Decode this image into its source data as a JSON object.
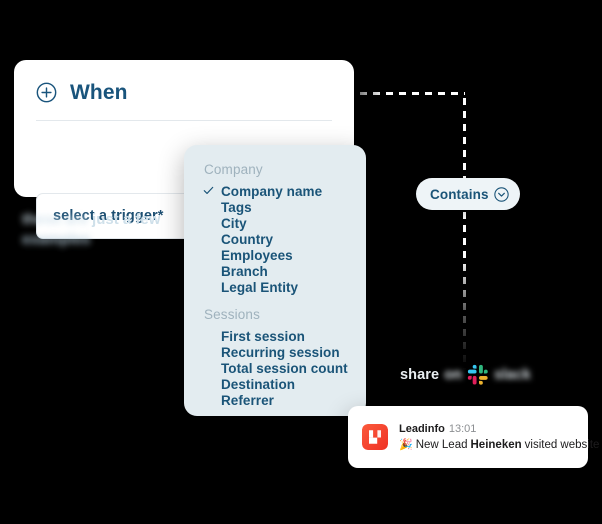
{
  "card": {
    "title": "When",
    "plus_icon": "circle-plus-icon",
    "trigger_placeholder": "select a trigger*"
  },
  "caption": {
    "obscured_prefix": "these are",
    "line1_visible": "just a few",
    "line2": "examples"
  },
  "dropdown": {
    "groups": [
      {
        "label": "Company",
        "items": [
          {
            "label": "Company name",
            "selected": true
          },
          {
            "label": "Tags",
            "selected": false
          },
          {
            "label": "City",
            "selected": false
          },
          {
            "label": "Country",
            "selected": false
          },
          {
            "label": "Employees",
            "selected": false
          },
          {
            "label": "Branch",
            "selected": false
          },
          {
            "label": "Legal Entity",
            "selected": false
          }
        ]
      },
      {
        "label": "Sessions",
        "items": [
          {
            "label": "First session",
            "selected": false
          },
          {
            "label": "Recurring session",
            "selected": false
          },
          {
            "label": "Total session count",
            "selected": false
          },
          {
            "label": "Destination",
            "selected": false
          },
          {
            "label": "Referrer",
            "selected": false
          }
        ]
      }
    ]
  },
  "condition": {
    "label": "Contains",
    "chevron_icon": "chevron-down-circle-icon"
  },
  "share": {
    "word": "share",
    "on": "on",
    "logo_icon": "slack-logo-icon",
    "product": "slack"
  },
  "notification": {
    "logo_icon": "leadinfo-logo-icon",
    "app_name": "Leadinfo",
    "time": "13:01",
    "emoji": "🎉",
    "message_prefix": "New Lead",
    "company": "Heineken",
    "message_suffix": "visited website"
  },
  "colors": {
    "background": "#000000",
    "card_bg": "#ffffff",
    "dropdown_bg": "#e3ecf0",
    "accent_navy": "#1a5478",
    "muted_label": "#9fb2bd",
    "pill_bg": "#eef4f7",
    "leadinfo_red": "#f5402c",
    "connector": "#ffffff"
  }
}
